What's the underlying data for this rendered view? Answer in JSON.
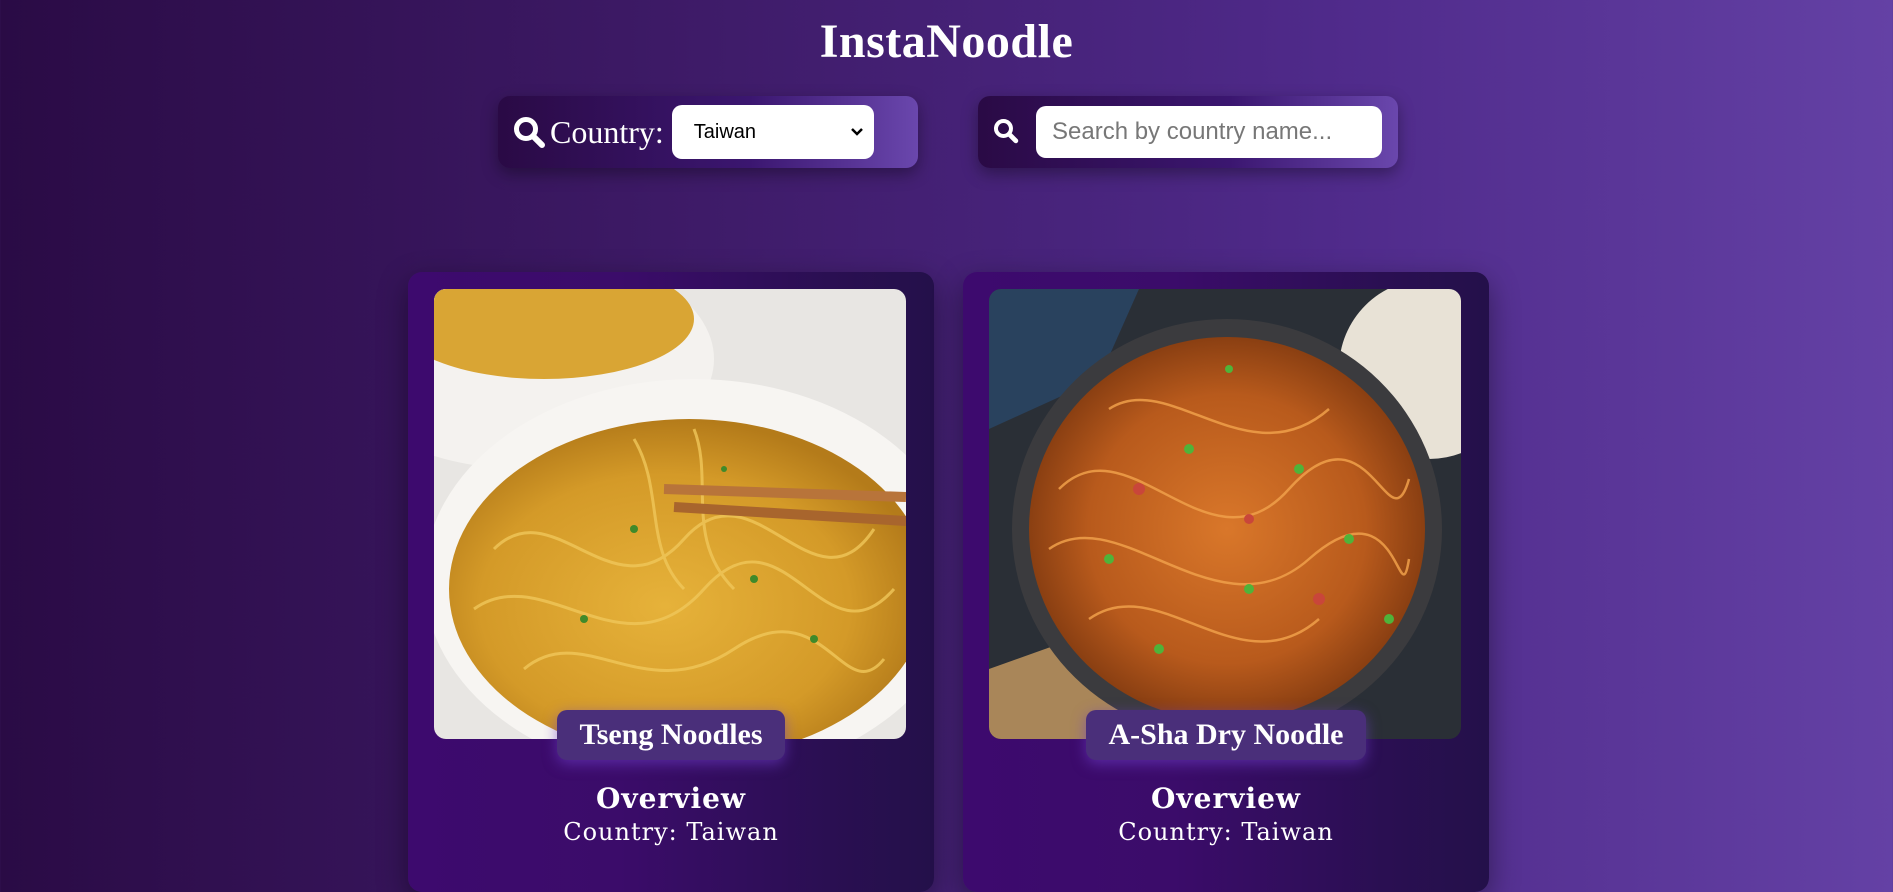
{
  "app": {
    "title": "InstaNoodle"
  },
  "filters": {
    "country_label": "Country:",
    "country_selected": "Taiwan",
    "search_placeholder": "Search by country name..."
  },
  "cards": [
    {
      "name": "Tseng Noodles",
      "overview_label": "Overview",
      "country_text": "Country: Taiwan"
    },
    {
      "name": "A-Sha Dry Noodle",
      "overview_label": "Overview",
      "country_text": "Country: Taiwan"
    }
  ]
}
